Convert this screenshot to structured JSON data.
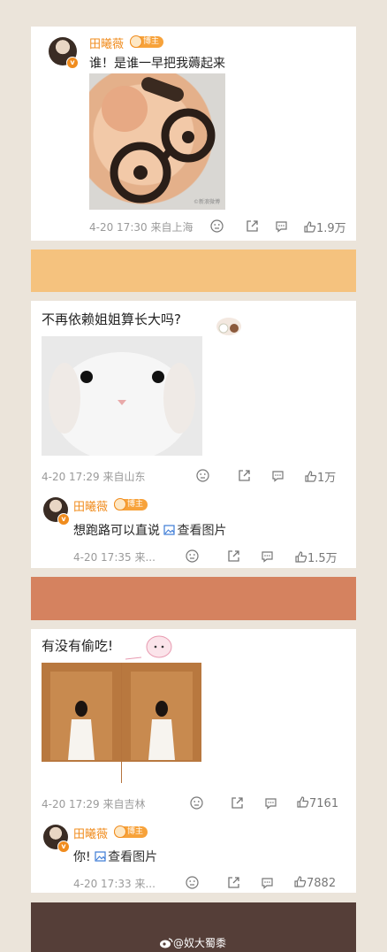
{
  "posts": [
    {
      "author": "田曦薇",
      "badge": "博主",
      "text": "谁！是谁一早把我薅起来",
      "image_watermark": "©新浪微博",
      "time": "4-20 17:30",
      "location": "来自上海",
      "likes": "1.9万"
    },
    {
      "text": "不再依赖姐姐算长大吗?",
      "time": "4-20 17:29",
      "location": "来自山东",
      "likes": "1万",
      "reply": {
        "author": "田曦薇",
        "badge": "博主",
        "text": "想跑路可以直说",
        "link": "查看图片",
        "time": "4-20 17:35",
        "location": "来...",
        "likes": "1.5万"
      }
    },
    {
      "text": "有没有偷吃!",
      "time": "4-20 17:29",
      "location": "来自吉林",
      "likes": "7161",
      "reply": {
        "author": "田曦薇",
        "badge": "博主",
        "text": "你!",
        "link": "查看图片",
        "time": "4-20 17:33",
        "location": "来...",
        "likes": "7882"
      }
    }
  ],
  "footer": {
    "watermark": "@奴大蜀黍"
  },
  "colors": {
    "band1": "#f5c27e",
    "band2": "#d5825f",
    "band3": "#553e38",
    "accent": "#f08c1e"
  }
}
